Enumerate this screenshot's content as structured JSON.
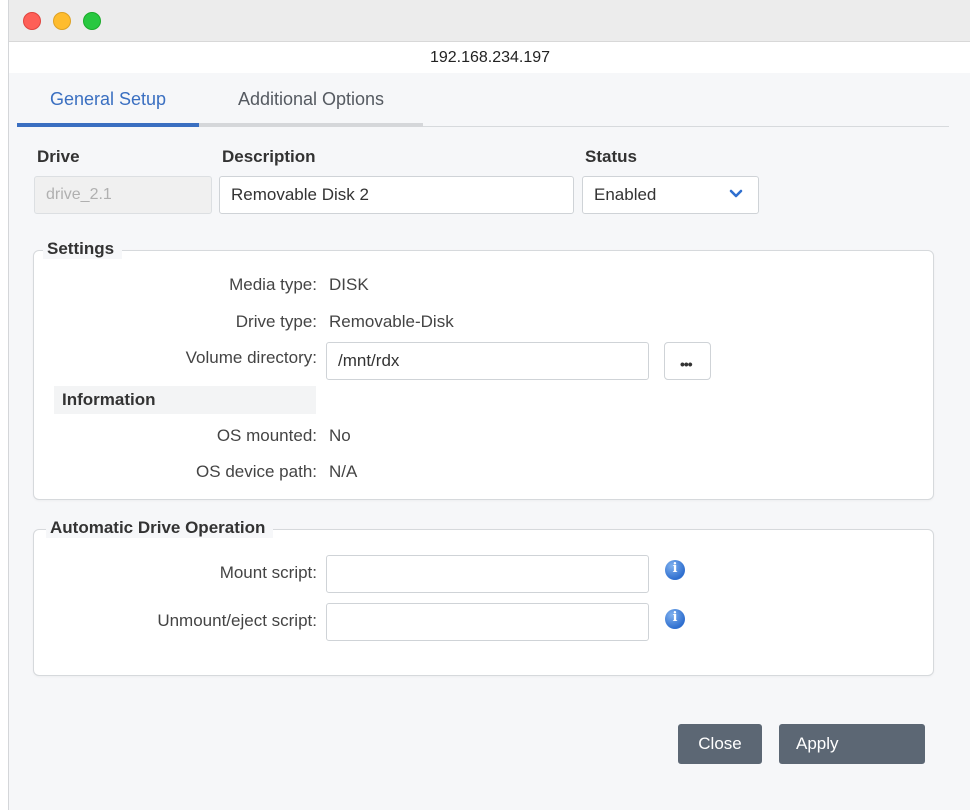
{
  "window": {
    "url": "192.168.234.197"
  },
  "tabs": [
    {
      "label": "General Setup",
      "active": true
    },
    {
      "label": "Additional Options",
      "active": false
    }
  ],
  "header": {
    "drive_label": "Drive",
    "description_label": "Description",
    "status_label": "Status",
    "drive_value": "drive_2.1",
    "description_value": "Removable Disk 2",
    "status_value": "Enabled"
  },
  "settings": {
    "legend": "Settings",
    "media_type_label": "Media type:",
    "media_type_value": "DISK",
    "drive_type_label": "Drive type:",
    "drive_type_value": "Removable-Disk",
    "volume_dir_label": "Volume directory:",
    "volume_dir_value": "/mnt/rdx",
    "browse_label": "•••",
    "information_heading": "Information",
    "os_mounted_label": "OS mounted:",
    "os_mounted_value": "No",
    "os_device_path_label": "OS device path:",
    "os_device_path_value": "N/A"
  },
  "automatic": {
    "legend": "Automatic Drive Operation",
    "mount_script_label": "Mount script:",
    "mount_script_value": "",
    "unmount_script_label": "Unmount/eject script:",
    "unmount_script_value": ""
  },
  "buttons": {
    "close": "Close",
    "apply": "Apply"
  },
  "colors": {
    "accent": "#3a6fc1",
    "button": "#5c6774",
    "info_icon": "#2f6fcf"
  },
  "icons": [
    "chevron-down-icon",
    "info-icon"
  ]
}
